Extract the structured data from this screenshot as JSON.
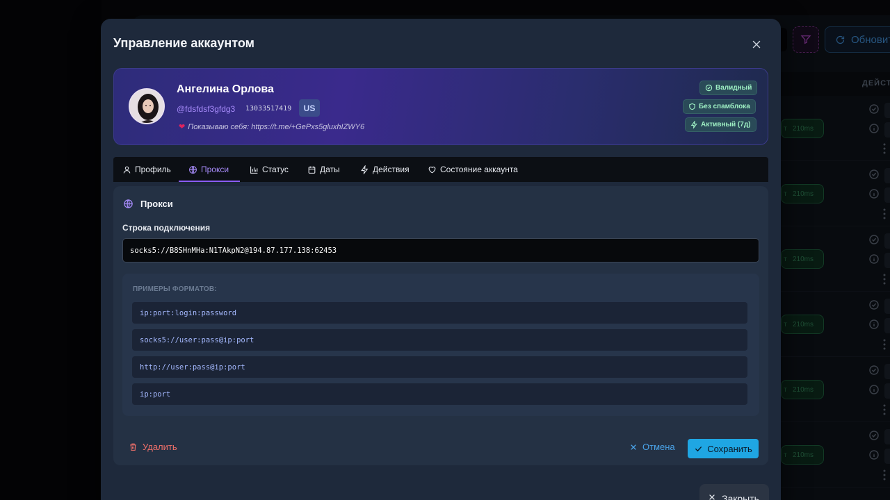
{
  "background": {
    "refresh_label": "Обновить",
    "actions_header": "ДЕЙСТ",
    "row_latency": "210ms",
    "row_chip_prefix": "т"
  },
  "modal": {
    "title": "Управление аккаунтом",
    "profile": {
      "name": "Ангелина Орлова",
      "username": "@fdsfdsf3gfdg3",
      "user_id": "13033517419",
      "country": "US",
      "bio": "Показываю себя: https://t.me/+GePxs5gluxhIZWY6",
      "badges": [
        {
          "label": "Валидный",
          "icon": "check-circle-icon"
        },
        {
          "label": "Без спамблока",
          "icon": "shield-icon"
        },
        {
          "label": "Активный (7д)",
          "icon": "lightning-icon"
        }
      ]
    },
    "tabs": [
      {
        "label": "Профиль",
        "icon": "user-icon"
      },
      {
        "label": "Прокси",
        "icon": "globe-icon",
        "active": true
      },
      {
        "label": "Статус",
        "icon": "bar-chart-icon"
      },
      {
        "label": "Даты",
        "icon": "calendar-icon"
      },
      {
        "label": "Действия",
        "icon": "lightning-icon"
      },
      {
        "label": "Состояние аккаунта",
        "icon": "heart-icon"
      }
    ],
    "proxy": {
      "section_title": "Прокси",
      "field_label": "Строка подключения",
      "value": "socks5://B8SHnMHa:N1TAkpN2@194.87.177.138:62453",
      "examples_title": "ПРИМЕРЫ ФОРМАТОВ:",
      "examples": [
        "ip:port:login:password",
        "socks5://user:pass@ip:port",
        "http://user:pass@ip:port",
        "ip:port"
      ]
    },
    "footer": {
      "delete_label": "Удалить",
      "cancel_label": "Отмена",
      "save_label": "Сохранить",
      "close_label": "Закрыть"
    }
  },
  "colors": {
    "accent_purple": "#8b5cf6",
    "save_blue": "#1fa6e3",
    "delete_red": "#f0706a",
    "badge_green": "#9ff0c4"
  }
}
